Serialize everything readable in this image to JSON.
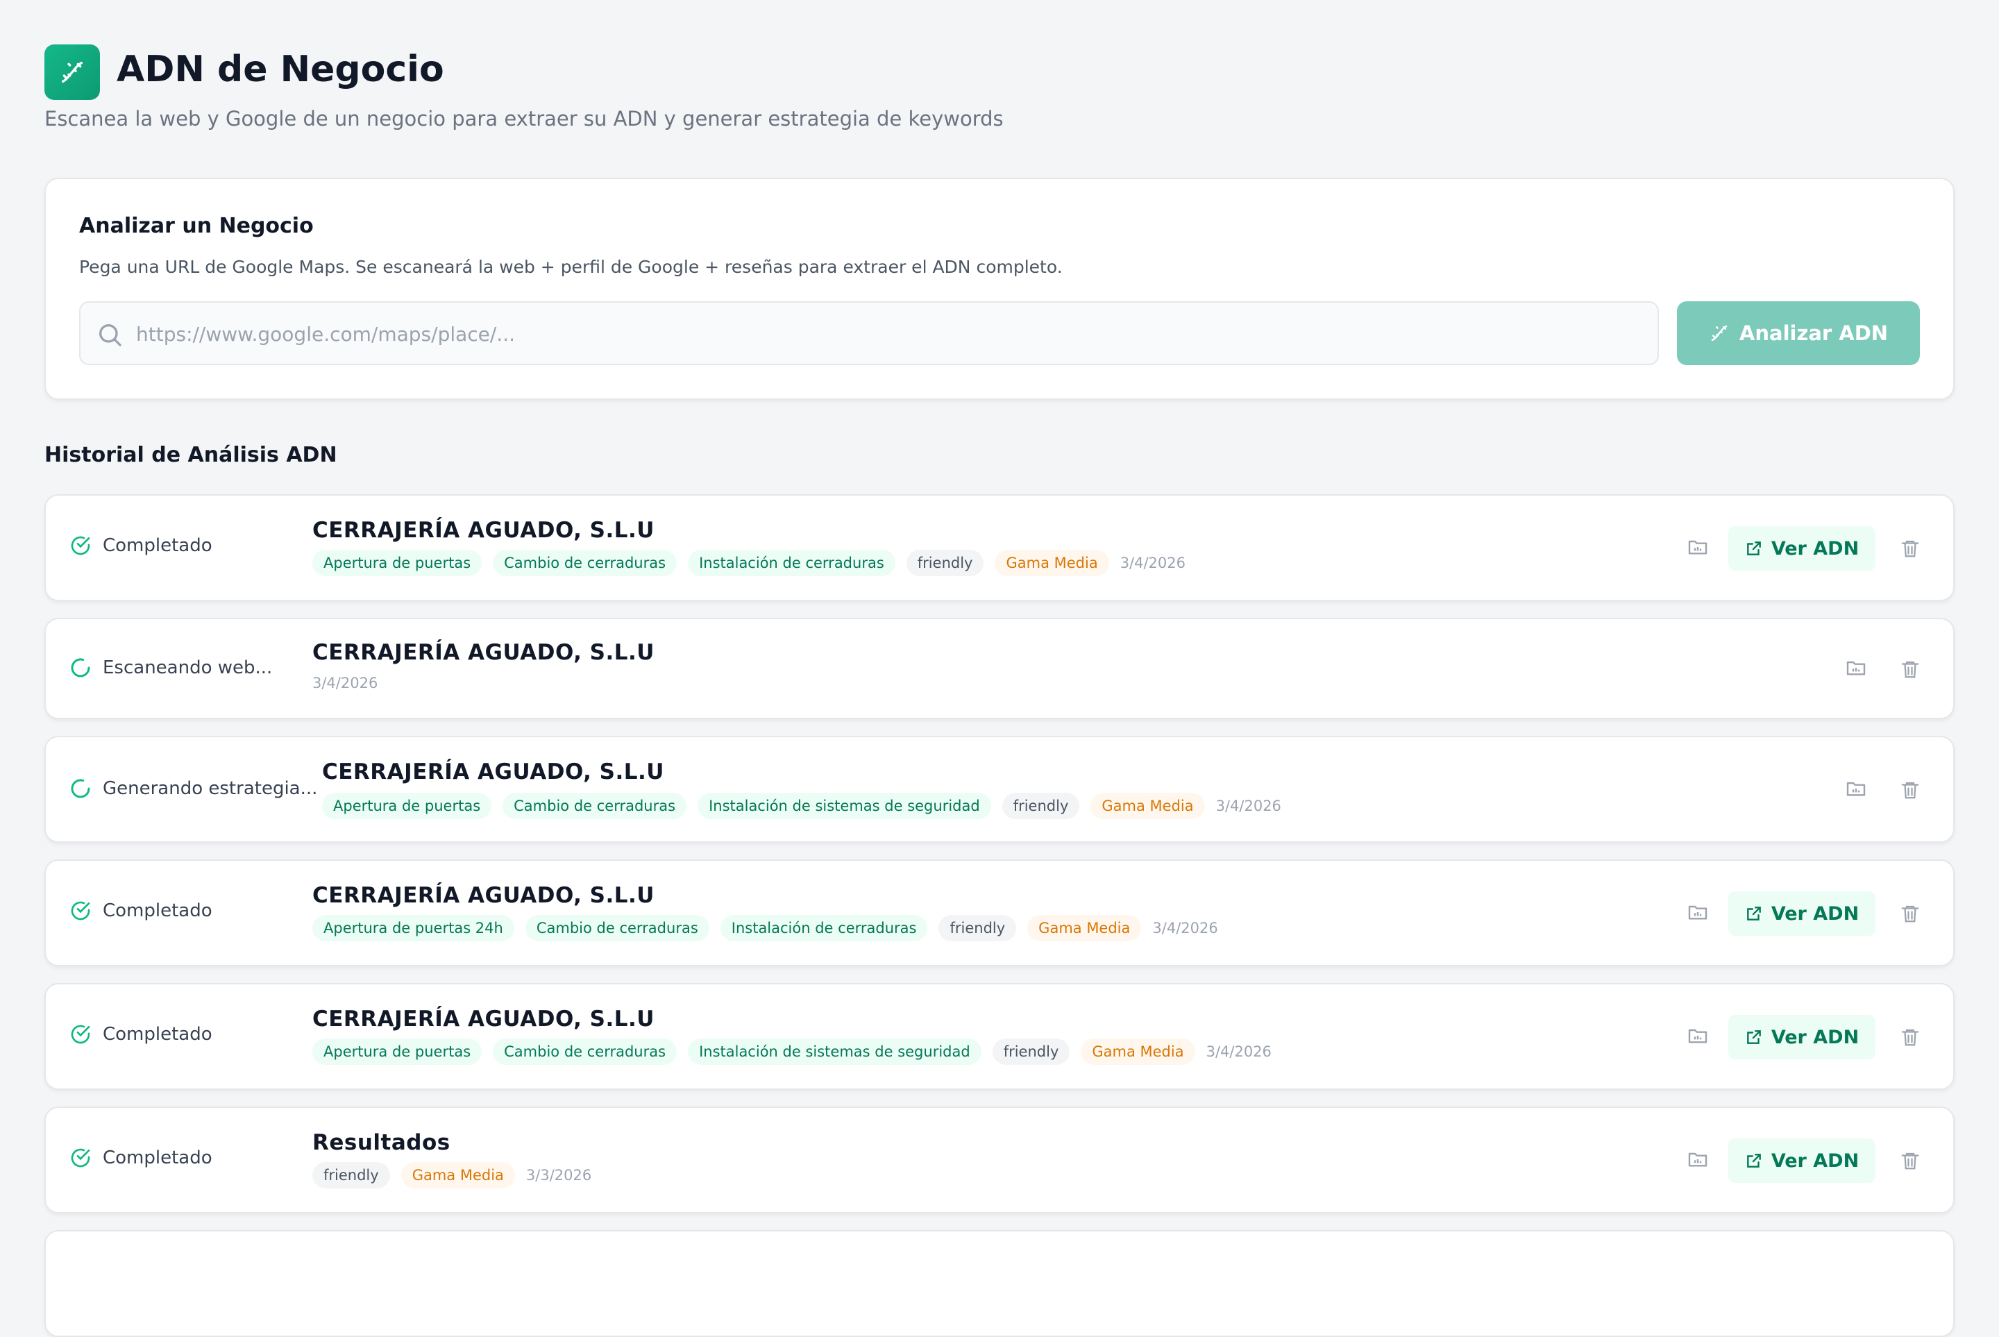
{
  "header": {
    "title": "ADN de Negocio",
    "subtitle": "Escanea la web y Google de un negocio para extraer su ADN y generar estrategia de keywords",
    "logo_icon": "dna-icon"
  },
  "analyze": {
    "title": "Analizar un Negocio",
    "description": "Pega una URL de Google Maps. Se escaneará la web + perfil de Google + reseñas para extraer el ADN completo.",
    "placeholder": "https://www.google.com/maps/place/...",
    "value": "",
    "button_label": "Analizar ADN"
  },
  "history": {
    "title": "Historial de Análisis ADN",
    "rows": [
      {
        "status": "Completado",
        "name": "CERRAJERÍA AGUADO, S.L.U",
        "services": [
          "Apertura de puertas",
          "Cambio de cerraduras",
          "Instalación de cerraduras"
        ],
        "tone": "friendly",
        "tone_icon": "",
        "tier": "Gama Media",
        "date": "3/4/2026",
        "action": "Ver ADN"
      },
      {
        "status": "Escaneando web...",
        "name": "CERRAJERÍA AGUADO, S.L.U",
        "date": "3/4/2026"
      },
      {
        "status": "Generando estrategia...",
        "name": "CERRAJERÍA AGUADO, S.L.U",
        "services": [
          "Apertura de puertas",
          "Cambio de cerraduras",
          "Instalación de sistemas de seguridad"
        ],
        "tone": "friendly",
        "tone_icon": "",
        "tier": "Gama Media",
        "date": "3/4/2026"
      },
      {
        "status": "Completado",
        "name": "CERRAJERÍA AGUADO, S.L.U",
        "services": [
          "Apertura de puertas 24h",
          "Cambio de cerraduras",
          "Instalación de cerraduras"
        ],
        "tone": "friendly",
        "tone_icon": "",
        "tier": "Gama Media",
        "date": "3/4/2026",
        "action": "Ver ADN"
      },
      {
        "status": "Completado",
        "name": "CERRAJERÍA AGUADO, S.L.U",
        "services": [
          "Apertura de puertas",
          "Cambio de cerraduras",
          "Instalación de sistemas de seguridad"
        ],
        "tone": "friendly",
        "tone_icon": "",
        "tier": "Gama Media",
        "date": "3/4/2026",
        "action": "Ver ADN"
      },
      {
        "status": "Completado",
        "name": "Resultados",
        "tone": "friendly",
        "tone_icon": "",
        "tier": "Gama Media",
        "date": "3/3/2026",
        "action": "Ver ADN"
      }
    ]
  },
  "colors": {
    "accent": "#10b981",
    "accent_dark": "#047857",
    "button_disabled": "#7ccbba",
    "tier_orange": "#d97706"
  }
}
